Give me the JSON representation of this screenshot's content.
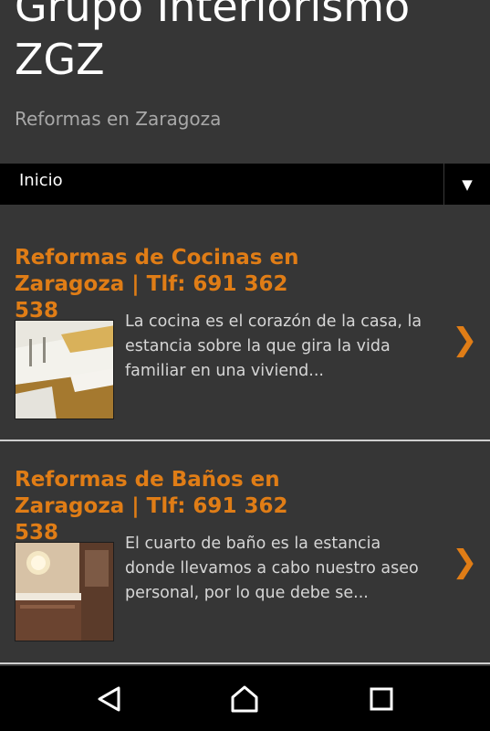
{
  "header": {
    "title_line1": "Grupo Interiorismo",
    "title_line2": "ZGZ",
    "subtitle": "Reformas en Zaragoza"
  },
  "nav": {
    "item": "Inicio",
    "toggle_glyph": "▼"
  },
  "articles": [
    {
      "title_line1": "Reformas de Cocinas en",
      "title_line2": "Zaragoza | Tlf: 691 362 538",
      "excerpt_lines": [
        "La cocina es el corazón de la casa, la",
        "estancia sobre la que gira la vida",
        "familiar en una viviend..."
      ],
      "chevron": "❯",
      "thumbnail_icon": "kitchen-photo"
    },
    {
      "title_line1": "Reformas de Baños en",
      "title_line2": "Zaragoza | Tlf: 691 362 538",
      "excerpt_lines": [
        "El cuarto de baño es la estancia",
        "donde llevamos a cabo nuestro aseo",
        "personal, por lo que debe se..."
      ],
      "chevron": "❯",
      "thumbnail_icon": "bathroom-photo"
    }
  ],
  "system_nav": {
    "icons": [
      "back-icon",
      "home-icon",
      "recents-icon"
    ]
  },
  "colors": {
    "background": "#363636",
    "accent": "#e07d16",
    "nav_bar": "#000000"
  }
}
